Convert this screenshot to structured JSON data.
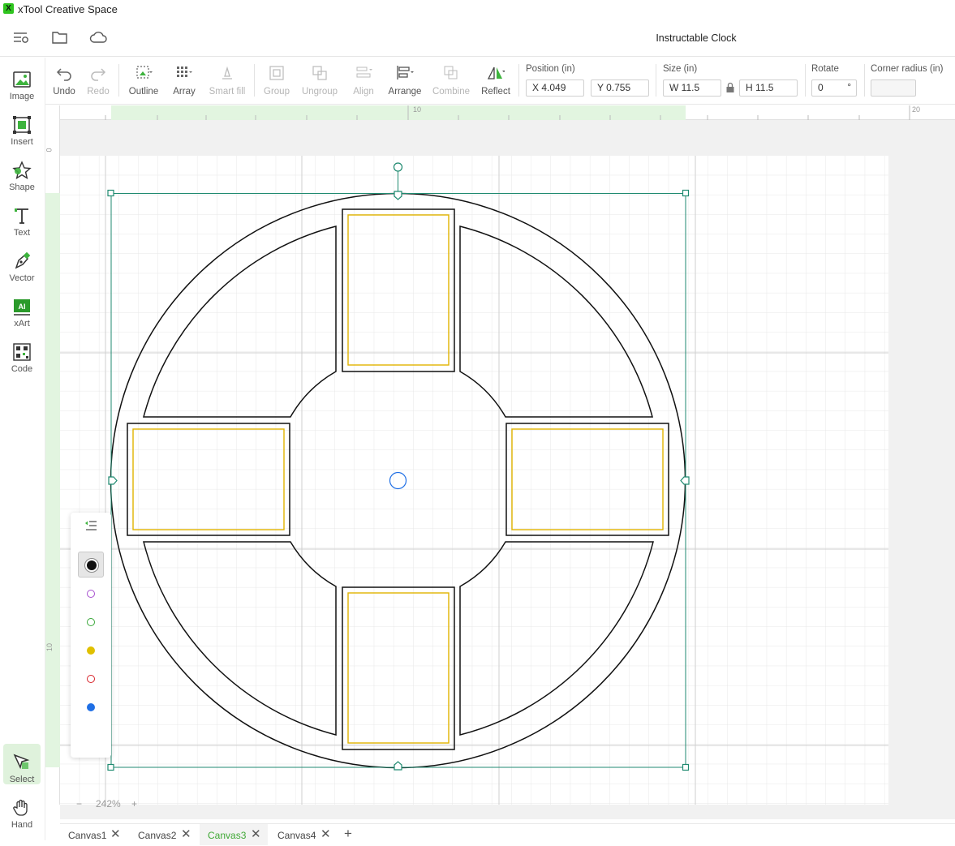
{
  "app": {
    "title": "xTool Creative Space",
    "icon_text": "X"
  },
  "header": {
    "project_title": "Instructable Clock",
    "icons": [
      "list-settings-icon",
      "folder-icon",
      "cloud-icon"
    ]
  },
  "left_tools": [
    {
      "label": "Image",
      "icon": "image-icon"
    },
    {
      "label": "Insert",
      "icon": "insert-icon"
    },
    {
      "label": "Shape",
      "icon": "shape-icon"
    },
    {
      "label": "Text",
      "icon": "text-icon"
    },
    {
      "label": "Vector",
      "icon": "vector-pen-icon"
    },
    {
      "label": "xArt",
      "icon": "xart-icon",
      "badge": "AI"
    },
    {
      "label": "Code",
      "icon": "qr-code-icon"
    },
    {
      "label": "Select",
      "icon": "select-cursor-icon",
      "active": true
    },
    {
      "label": "Hand",
      "icon": "hand-icon"
    }
  ],
  "toolbar": {
    "undo": "Undo",
    "redo": "Redo",
    "outline": "Outline",
    "array": "Array",
    "smart_fill": "Smart fill",
    "group": "Group",
    "ungroup": "Ungroup",
    "align": "Align",
    "arrange": "Arrange",
    "combine": "Combine",
    "reflect": "Reflect",
    "position_label": "Position (in)",
    "x_value": "X 4.049",
    "y_value": "Y 0.755",
    "size_label": "Size (in)",
    "w_value": "W 11.5",
    "h_value": "H 11.5",
    "rotate_label": "Rotate",
    "rotate_value": "0",
    "rotate_unit": "°",
    "corner_label": "Corner radius (in)",
    "corner_value": ""
  },
  "rulers": {
    "top_labels": [
      "10",
      "20"
    ],
    "left_labels": [
      "0",
      "10"
    ]
  },
  "layers": [
    {
      "color": "#555555",
      "style": "filled",
      "active": true
    },
    {
      "color": "#a64fcf",
      "style": "ring"
    },
    {
      "color": "#3aa83a",
      "style": "ring"
    },
    {
      "color": "#e0c000",
      "style": "filled"
    },
    {
      "color": "#d8232a",
      "style": "ring"
    },
    {
      "color": "#1f6fe5",
      "style": "filled"
    }
  ],
  "zoom": {
    "minus": "−",
    "value": "242%",
    "plus": "+"
  },
  "tabs": [
    {
      "label": "Canvas1",
      "active": false
    },
    {
      "label": "Canvas2",
      "active": false
    },
    {
      "label": "Canvas3",
      "active": true
    },
    {
      "label": "Canvas4",
      "active": false
    }
  ],
  "add_tab": "+",
  "colors": {
    "accent": "#40a936",
    "selection": "#1f8a70",
    "cut_line": "#111111",
    "engrave_line": "#e0b400",
    "pivot": "#1f6fe5"
  }
}
